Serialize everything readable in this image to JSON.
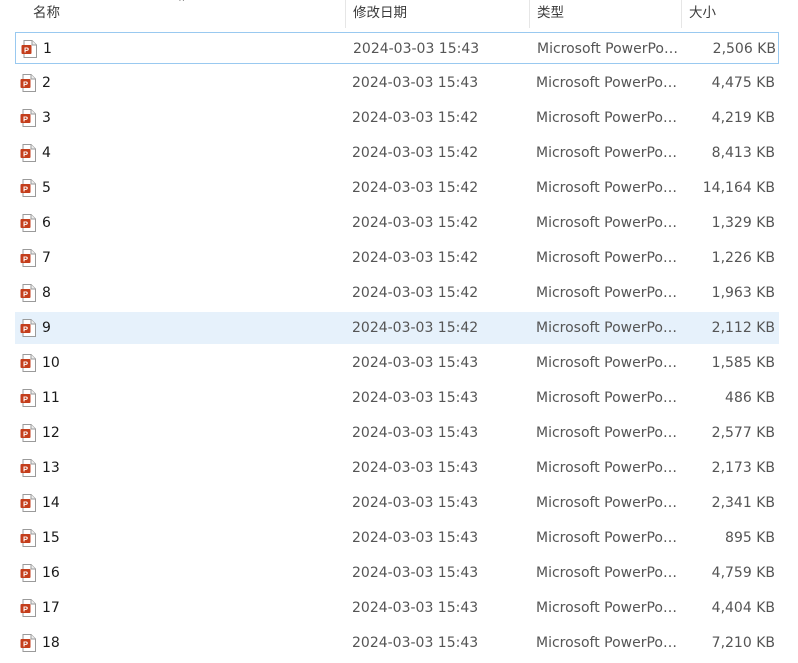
{
  "columns": {
    "name": "名称",
    "date": "修改日期",
    "type": "类型",
    "size": "大小"
  },
  "colors": {
    "selected_bg": "#e6f1fb",
    "focus_border": "#99c9f0",
    "ppt_icon": "#c43e1c"
  },
  "files": [
    {
      "name": "1",
      "date": "2024-03-03 15:43",
      "type": "Microsoft PowerPoi...",
      "size": "2,506 KB"
    },
    {
      "name": "2",
      "date": "2024-03-03 15:43",
      "type": "Microsoft PowerPoi...",
      "size": "4,475 KB"
    },
    {
      "name": "3",
      "date": "2024-03-03 15:42",
      "type": "Microsoft PowerPoi...",
      "size": "4,219 KB"
    },
    {
      "name": "4",
      "date": "2024-03-03 15:42",
      "type": "Microsoft PowerPoi...",
      "size": "8,413 KB"
    },
    {
      "name": "5",
      "date": "2024-03-03 15:42",
      "type": "Microsoft PowerPoi...",
      "size": "14,164 KB"
    },
    {
      "name": "6",
      "date": "2024-03-03 15:42",
      "type": "Microsoft PowerPoi...",
      "size": "1,329 KB"
    },
    {
      "name": "7",
      "date": "2024-03-03 15:42",
      "type": "Microsoft PowerPoi...",
      "size": "1,226 KB"
    },
    {
      "name": "8",
      "date": "2024-03-03 15:42",
      "type": "Microsoft PowerPoi...",
      "size": "1,963 KB"
    },
    {
      "name": "9",
      "date": "2024-03-03 15:42",
      "type": "Microsoft PowerPoi...",
      "size": "2,112 KB"
    },
    {
      "name": "10",
      "date": "2024-03-03 15:43",
      "type": "Microsoft PowerPoi...",
      "size": "1,585 KB"
    },
    {
      "name": "11",
      "date": "2024-03-03 15:43",
      "type": "Microsoft PowerPoi...",
      "size": "486 KB"
    },
    {
      "name": "12",
      "date": "2024-03-03 15:43",
      "type": "Microsoft PowerPoi...",
      "size": "2,577 KB"
    },
    {
      "name": "13",
      "date": "2024-03-03 15:43",
      "type": "Microsoft PowerPoi...",
      "size": "2,173 KB"
    },
    {
      "name": "14",
      "date": "2024-03-03 15:43",
      "type": "Microsoft PowerPoi...",
      "size": "2,341 KB"
    },
    {
      "name": "15",
      "date": "2024-03-03 15:43",
      "type": "Microsoft PowerPoi...",
      "size": "895 KB"
    },
    {
      "name": "16",
      "date": "2024-03-03 15:43",
      "type": "Microsoft PowerPoi...",
      "size": "4,759 KB"
    },
    {
      "name": "17",
      "date": "2024-03-03 15:43",
      "type": "Microsoft PowerPoi...",
      "size": "4,404 KB"
    },
    {
      "name": "18",
      "date": "2024-03-03 15:43",
      "type": "Microsoft PowerPoi...",
      "size": "7,210 KB"
    }
  ]
}
